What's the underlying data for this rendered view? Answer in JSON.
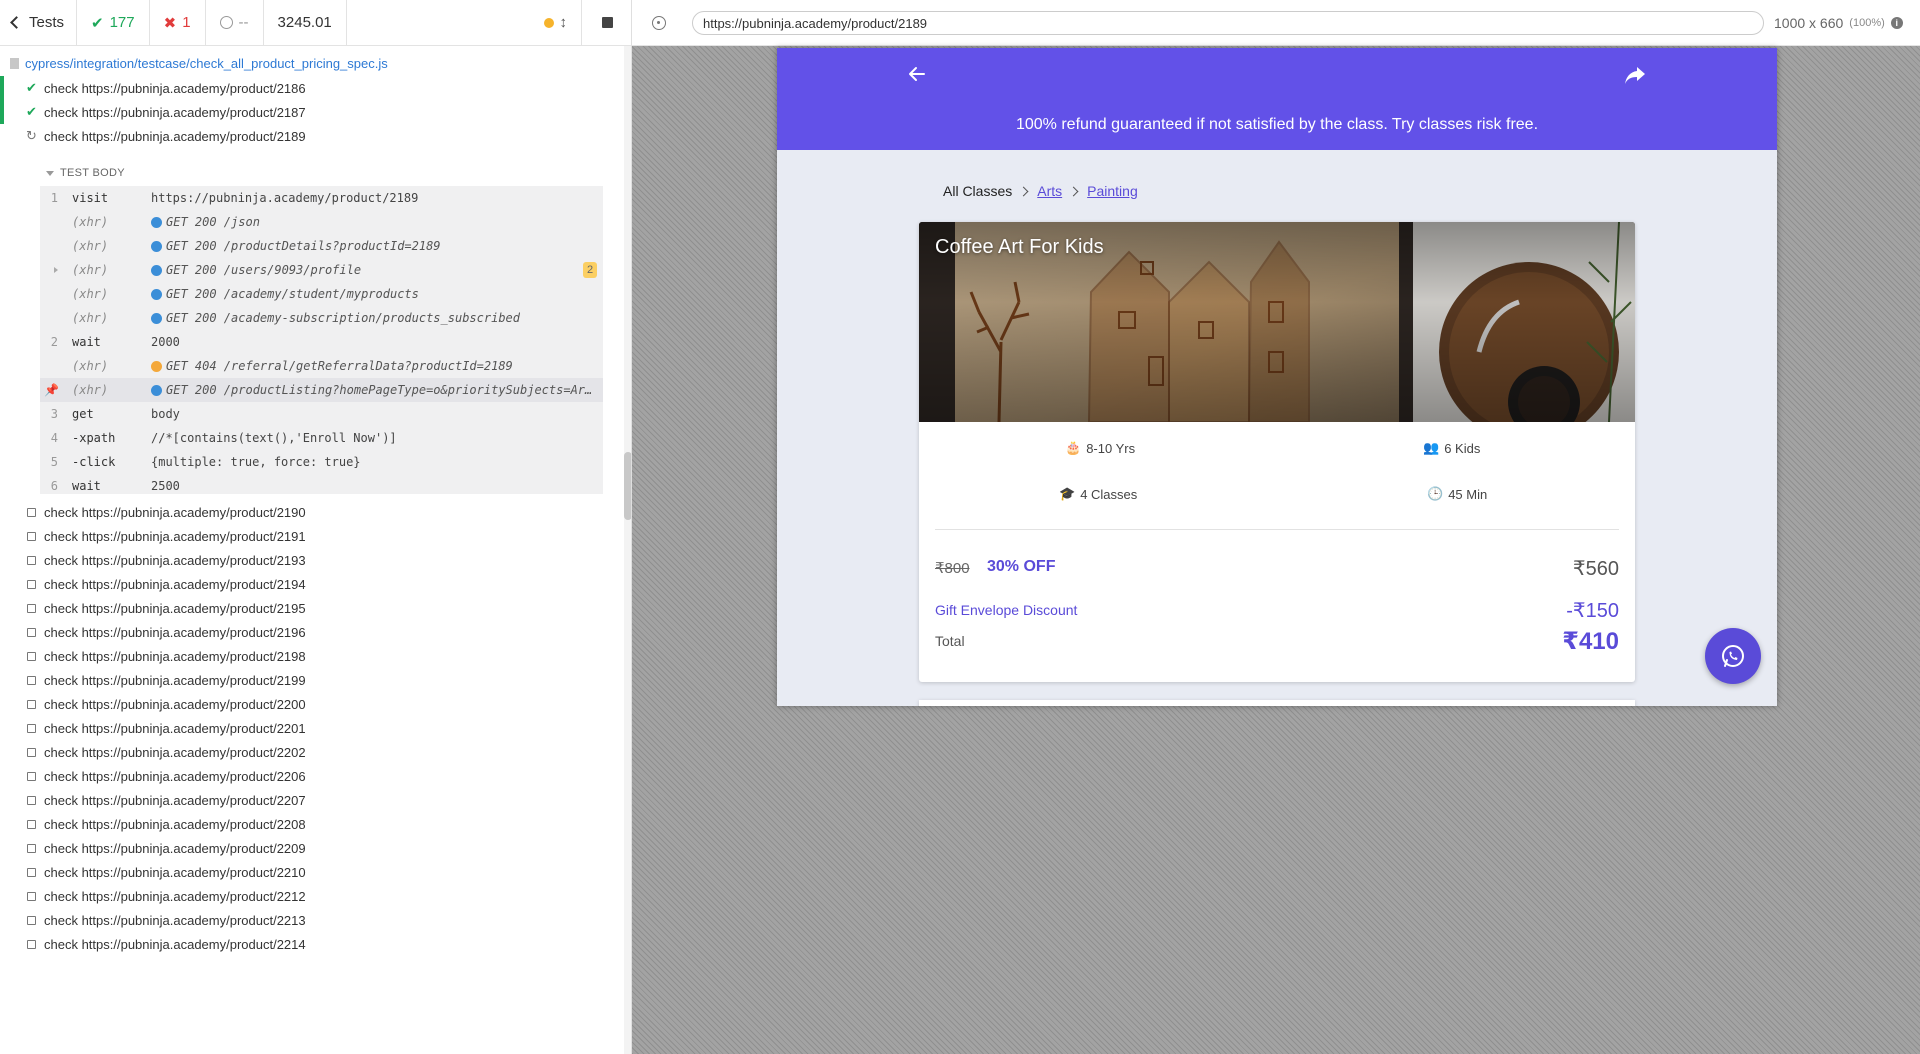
{
  "reporter": {
    "tests_button": "Tests",
    "passed_count": "177",
    "failed_count": "1",
    "pending_count": "--",
    "duration": "3245.01",
    "spec_path": "cypress/integration/testcase/check_all_product_pricing_spec.js",
    "tests": [
      {
        "label": "check https://pubninja.academy/product/2186",
        "state": "passed"
      },
      {
        "label": "check https://pubninja.academy/product/2187",
        "state": "passed"
      },
      {
        "label": "check https://pubninja.academy/product/2189",
        "state": "running"
      },
      {
        "label": "check https://pubninja.academy/product/2190",
        "state": "pending"
      },
      {
        "label": "check https://pubninja.academy/product/2191",
        "state": "pending"
      },
      {
        "label": "check https://pubninja.academy/product/2193",
        "state": "pending"
      },
      {
        "label": "check https://pubninja.academy/product/2194",
        "state": "pending"
      },
      {
        "label": "check https://pubninja.academy/product/2195",
        "state": "pending"
      },
      {
        "label": "check https://pubninja.academy/product/2196",
        "state": "pending"
      },
      {
        "label": "check https://pubninja.academy/product/2198",
        "state": "pending"
      },
      {
        "label": "check https://pubninja.academy/product/2199",
        "state": "pending"
      },
      {
        "label": "check https://pubninja.academy/product/2200",
        "state": "pending"
      },
      {
        "label": "check https://pubninja.academy/product/2201",
        "state": "pending"
      },
      {
        "label": "check https://pubninja.academy/product/2202",
        "state": "pending"
      },
      {
        "label": "check https://pubninja.academy/product/2206",
        "state": "pending"
      },
      {
        "label": "check https://pubninja.academy/product/2207",
        "state": "pending"
      },
      {
        "label": "check https://pubninja.academy/product/2208",
        "state": "pending"
      },
      {
        "label": "check https://pubninja.academy/product/2209",
        "state": "pending"
      },
      {
        "label": "check https://pubninja.academy/product/2210",
        "state": "pending"
      },
      {
        "label": "check https://pubninja.academy/product/2212",
        "state": "pending"
      },
      {
        "label": "check https://pubninja.academy/product/2213",
        "state": "pending"
      },
      {
        "label": "check https://pubninja.academy/product/2214",
        "state": "pending"
      }
    ],
    "test_body_label": "TEST BODY",
    "commands": [
      {
        "num": "1",
        "name": "visit",
        "msg": "https://pubninja.academy/product/2189"
      },
      {
        "num": "",
        "name": "(xhr)",
        "msg": "GET 200 /json",
        "dot": "blue"
      },
      {
        "num": "",
        "name": "(xhr)",
        "msg": "GET 200 /productDetails?productId=2189",
        "dot": "blue"
      },
      {
        "num": "",
        "name": "(xhr)",
        "msg": "GET 200 /users/9093/profile",
        "dot": "blue",
        "badge": "2"
      },
      {
        "num": "",
        "name": "(xhr)",
        "msg": "GET 200 /academy/student/myproducts",
        "dot": "blue"
      },
      {
        "num": "",
        "name": "(xhr)",
        "msg": "GET 200 /academy-subscription/products_subscribed",
        "dot": "blue"
      },
      {
        "num": "2",
        "name": "wait",
        "msg": "2000"
      },
      {
        "num": "",
        "name": "(xhr)",
        "msg": "GET 404 /referral/getReferralData?productId=2189",
        "dot": "orange"
      },
      {
        "num": "",
        "name": "(xhr)",
        "msg": "GET 200 /productListing?homePageType=o&prioritySubjects=Ar…",
        "dot": "blue"
      },
      {
        "num": "3",
        "name": "get",
        "msg": "body"
      },
      {
        "num": "4",
        "name": "-xpath",
        "msg": "//*[contains(text(),'Enroll Now')]"
      },
      {
        "num": "5",
        "name": "-click",
        "msg": "{multiple: true, force: true}"
      },
      {
        "num": "6",
        "name": "wait",
        "msg": "2500"
      }
    ]
  },
  "aut": {
    "url": "https://pubninja.academy/product/2189",
    "viewport_size": "1000 x 660",
    "viewport_scale": "(100%)"
  },
  "app": {
    "refund_banner": "100% refund guaranteed if not satisfied by the class. Try classes risk free.",
    "breadcrumb": {
      "root": "All Classes",
      "category": "Arts",
      "subcategory": "Painting"
    },
    "product": {
      "title": "Coffee Art For Kids",
      "age": "8-10 Yrs",
      "kids": "6 Kids",
      "classes": "4 Classes",
      "duration": "45 Min",
      "original_price": "₹800",
      "discount": "30% OFF",
      "sale_price": "₹560",
      "gift_label": "Gift Envelope Discount",
      "gift_value": "-₹150",
      "total_label": "Total",
      "total_value": "₹410"
    }
  },
  "colors": {
    "brand": "#6251e8",
    "accent": "#5a4bd8",
    "pass": "#1ea85a",
    "fail": "#e13c3c"
  }
}
